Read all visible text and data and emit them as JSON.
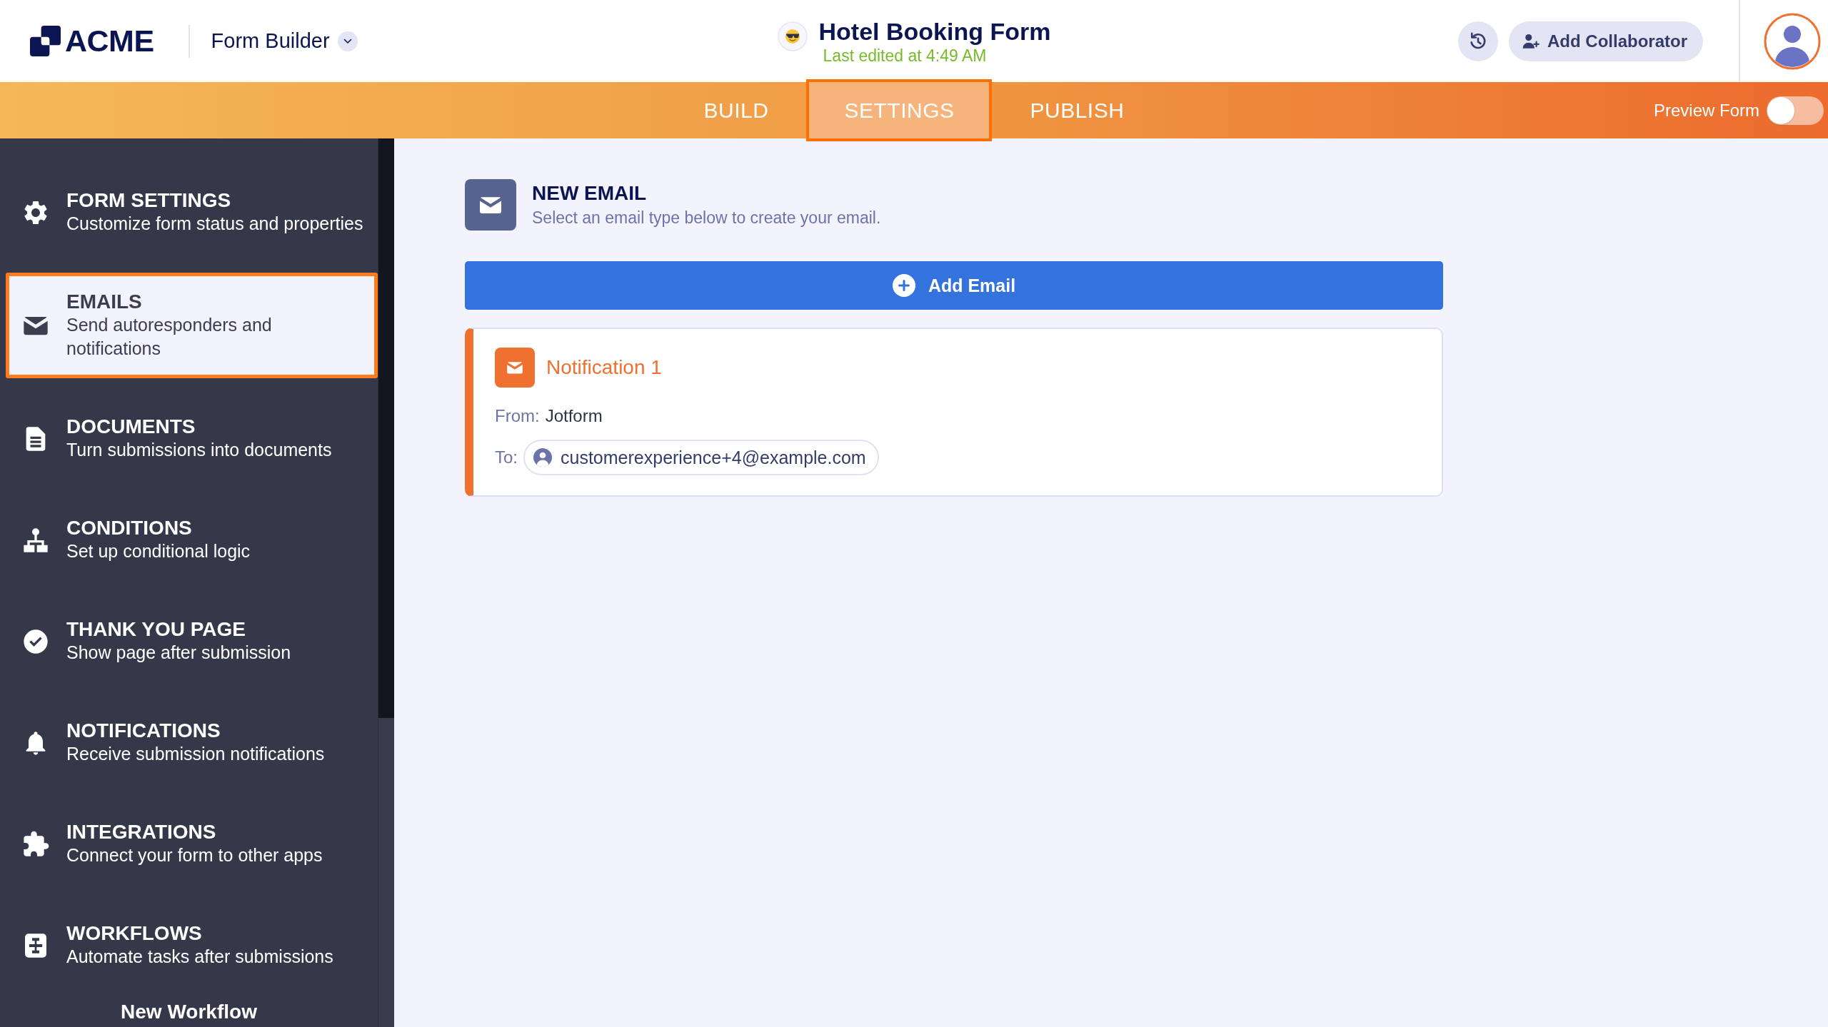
{
  "header": {
    "logo": "ACME",
    "app_menu": "Form Builder",
    "form_title": "Hotel Booking Form",
    "last_edited": "Last edited at 4:49 AM",
    "add_collaborator": "Add Collaborator"
  },
  "tabs": [
    {
      "label": "BUILD",
      "selected": false
    },
    {
      "label": "SETTINGS",
      "selected": true
    },
    {
      "label": "PUBLISH",
      "selected": false
    }
  ],
  "preview_form": {
    "label": "Preview Form",
    "on": false
  },
  "sidebar": {
    "items": [
      {
        "title": "FORM SETTINGS",
        "description": "Customize form status and properties",
        "selected": false
      },
      {
        "title": "EMAILS",
        "description": "Send autoresponders and notifications",
        "selected": true
      },
      {
        "title": "DOCUMENTS",
        "description": "Turn submissions into documents",
        "selected": false
      },
      {
        "title": "CONDITIONS",
        "description": "Set up conditional logic",
        "selected": false
      },
      {
        "title": "THANK YOU PAGE",
        "description": "Show page after submission",
        "selected": false
      },
      {
        "title": "NOTIFICATIONS",
        "description": "Receive submission notifications",
        "selected": false
      },
      {
        "title": "INTEGRATIONS",
        "description": "Connect your form to other apps",
        "selected": false
      },
      {
        "title": "WORKFLOWS",
        "description": "Automate tasks after submissions",
        "selected": false
      }
    ],
    "footer_button": "New Workflow"
  },
  "new_email": {
    "title": "NEW EMAIL",
    "subtitle": "Select an email type below to create your email.",
    "add_button": "Add Email"
  },
  "emails": [
    {
      "name": "Notification 1",
      "from_label": "From:",
      "from": "Jotform",
      "to_label": "To:",
      "to": "customerexperience+4@example.com"
    }
  ]
}
